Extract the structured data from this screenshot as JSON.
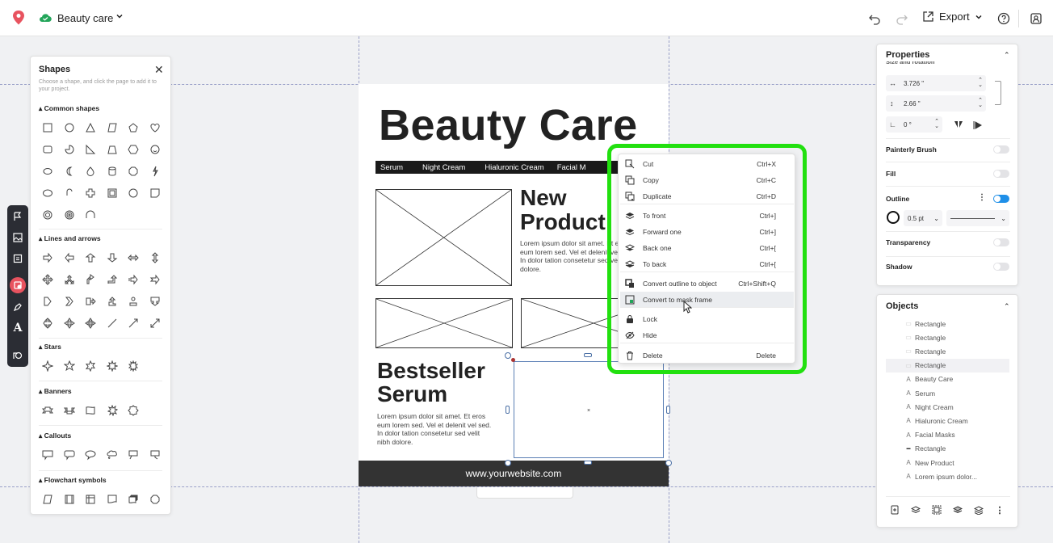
{
  "topbar": {
    "project_title": "Beauty care",
    "export_label": "Export"
  },
  "page": {
    "title": "Beauty Care",
    "bar_items": [
      "Serum",
      "Night Cream",
      "Hialuronic Cream",
      "Facial M"
    ],
    "new_product": [
      "New",
      "Product"
    ],
    "lorem_top": "Lorem ipsum dolor sit amet. Et eros eum lorem sed. Vel et delenit velit nibh In dolor tation consetetur sed velit nibh dolore.",
    "bestseller": [
      "Bestseller",
      "Serum"
    ],
    "lorem_bottom": "Lorem ipsum dolor sit amet. Et eros eum lorem sed. Vel et delenit vel sed. In dolor tation consetetur sed velit nibh dolore.",
    "footer": "www.yourwebsite.com"
  },
  "shapes_panel": {
    "title": "Shapes",
    "description": "Choose a shape, and click the page to add it to your project.",
    "sections": [
      "Common shapes",
      "Lines and arrows",
      "Stars",
      "Banners",
      "Callouts",
      "Flowchart symbols"
    ]
  },
  "properties": {
    "title": "Properties",
    "size_label": "Size and rotation",
    "width": "3.726 \"",
    "height": "2.66 \"",
    "rotation": "0 °",
    "painterly_brush": "Painterly Brush",
    "fill": "Fill",
    "outline": "Outline",
    "outline_width": "0.5 pt",
    "transparency": "Transparency",
    "shadow": "Shadow",
    "outline_on": true
  },
  "objects": {
    "title": "Objects",
    "items": [
      {
        "icon": "rect",
        "label": "Rectangle"
      },
      {
        "icon": "rect",
        "label": "Rectangle"
      },
      {
        "icon": "rect",
        "label": "Rectangle"
      },
      {
        "icon": "rect",
        "label": "Rectangle",
        "highlighted": true
      },
      {
        "icon": "text",
        "label": "Beauty Care"
      },
      {
        "icon": "text",
        "label": "Serum"
      },
      {
        "icon": "text",
        "label": "Night Cream"
      },
      {
        "icon": "text",
        "label": "Hialuronic Cream"
      },
      {
        "icon": "text",
        "label": "Facial Masks"
      },
      {
        "icon": "line",
        "label": "Rectangle"
      },
      {
        "icon": "text",
        "label": "New Product"
      },
      {
        "icon": "text",
        "label": "Lorem ipsum dolor..."
      }
    ]
  },
  "context_menu": {
    "items": [
      {
        "label": "Cut",
        "shortcut": "Ctrl+X",
        "icon": "cut-icon"
      },
      {
        "label": "Copy",
        "shortcut": "Ctrl+C",
        "icon": "copy-icon"
      },
      {
        "label": "Duplicate",
        "shortcut": "Ctrl+D",
        "icon": "duplicate-icon"
      },
      {
        "label": "To front",
        "shortcut": "Ctrl+]",
        "icon": "to-front-icon"
      },
      {
        "label": "Forward one",
        "shortcut": "Ctrl+]",
        "icon": "forward-one-icon"
      },
      {
        "label": "Back one",
        "shortcut": "Ctrl+[",
        "icon": "back-one-icon"
      },
      {
        "label": "To back",
        "shortcut": "Ctrl+[",
        "icon": "to-back-icon"
      },
      {
        "label": "Convert outline to object",
        "shortcut": "Ctrl+Shift+Q",
        "icon": "convert-outline-icon"
      },
      {
        "label": "Convert to mask frame",
        "shortcut": "",
        "icon": "mask-frame-icon"
      },
      {
        "label": "Lock",
        "shortcut": "",
        "icon": "lock-icon"
      },
      {
        "label": "Hide",
        "shortcut": "",
        "icon": "hide-icon"
      },
      {
        "label": "Delete",
        "shortcut": "Delete",
        "icon": "trash-icon"
      }
    ]
  },
  "colors": {
    "accent": "#1f8fe8",
    "highlight": "#22e00f",
    "active_tool": "#e8535f"
  }
}
